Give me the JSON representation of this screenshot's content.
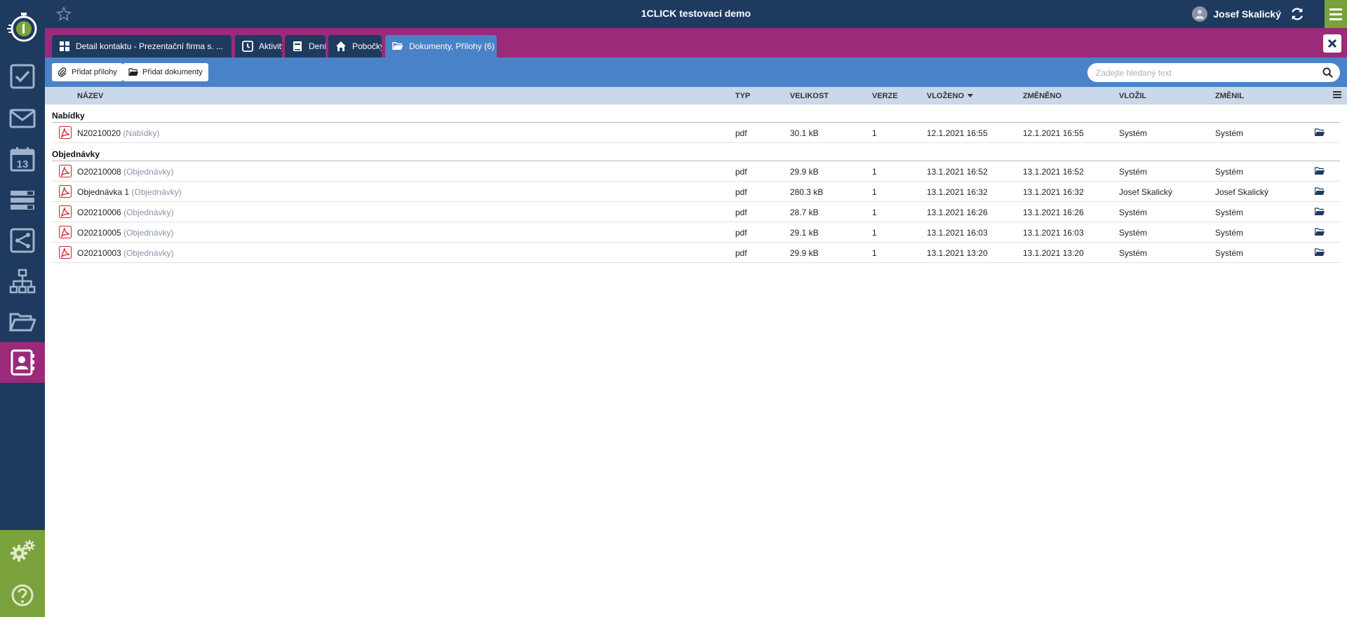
{
  "app": {
    "title": "1CLICK testovací demo"
  },
  "user": {
    "name": "Josef Skalický"
  },
  "colors": {
    "navy": "#1e3a5f",
    "magenta": "#9b2a7a",
    "blue": "#4a82c7",
    "green": "#7aa23c",
    "header": "#c9d8ea",
    "pdf_red": "#d0202a"
  },
  "sidebar": {
    "items": [
      {
        "icon": "checkbox-icon"
      },
      {
        "icon": "envelope-icon"
      },
      {
        "icon": "calendar-icon",
        "text": "13"
      },
      {
        "icon": "list-icon"
      },
      {
        "icon": "workflow-icon"
      },
      {
        "icon": "org-chart-icon"
      },
      {
        "icon": "folder-open-icon"
      },
      {
        "icon": "contact-card-icon",
        "active": true
      }
    ],
    "bottom": [
      {
        "icon": "gears-icon"
      },
      {
        "icon": "help-icon"
      }
    ]
  },
  "tabs": [
    {
      "label": "Detail kontaktu - Prezentační firma s. ...",
      "icon": "grid-icon"
    },
    {
      "label": "Aktivity",
      "icon": "clock-icon"
    },
    {
      "label": "Deník",
      "icon": "book-icon"
    },
    {
      "label": "Pobočky",
      "icon": "home-icon"
    },
    {
      "label": "Dokumenty, Přílohy (6)",
      "icon": "folder-icon",
      "active": true
    }
  ],
  "toolbar": {
    "add_attachments": "Přidat přílohy",
    "add_documents": "Přidat dokumenty",
    "search_placeholder": "Zadejte hledaný text"
  },
  "table": {
    "headers": {
      "name": "NÁZEV",
      "type": "TYP",
      "size": "VELIKOST",
      "version": "VERZE",
      "inserted": "VLOŽENO",
      "changed": "ZMĚNĚNO",
      "inserted_by": "VLOŽIL",
      "changed_by": "ZMĚNIL"
    },
    "sorted_by": "inserted",
    "groups": [
      {
        "title": "Nabídky",
        "rows": [
          {
            "name": "N20210020",
            "category": "(Nabídky)",
            "type": "pdf",
            "size": "30.1 kB",
            "version": "1",
            "inserted": "12.1.2021 16:55",
            "changed": "12.1.2021 16:55",
            "inserted_by": "Systém",
            "changed_by": "Systém"
          }
        ]
      },
      {
        "title": "Objednávky",
        "rows": [
          {
            "name": "O20210008",
            "category": "(Objednávky)",
            "type": "pdf",
            "size": "29.9 kB",
            "version": "1",
            "inserted": "13.1.2021 16:52",
            "changed": "13.1.2021 16:52",
            "inserted_by": "Systém",
            "changed_by": "Systém"
          },
          {
            "name": "Objednávka 1",
            "category": "(Objednávky)",
            "type": "pdf",
            "size": "280.3 kB",
            "version": "1",
            "inserted": "13.1.2021 16:32",
            "changed": "13.1.2021 16:32",
            "inserted_by": "Josef Skalický",
            "changed_by": "Josef Skalický"
          },
          {
            "name": "O20210006",
            "category": "(Objednávky)",
            "type": "pdf",
            "size": "28.7 kB",
            "version": "1",
            "inserted": "13.1.2021 16:26",
            "changed": "13.1.2021 16:26",
            "inserted_by": "Systém",
            "changed_by": "Systém"
          },
          {
            "name": "O20210005",
            "category": "(Objednávky)",
            "type": "pdf",
            "size": "29.1 kB",
            "version": "1",
            "inserted": "13.1.2021 16:03",
            "changed": "13.1.2021 16:03",
            "inserted_by": "Systém",
            "changed_by": "Systém"
          },
          {
            "name": "O20210003",
            "category": "(Objednávky)",
            "type": "pdf",
            "size": "29.9 kB",
            "version": "1",
            "inserted": "13.1.2021 13:20",
            "changed": "13.1.2021 13:20",
            "inserted_by": "Systém",
            "changed_by": "Systém"
          }
        ]
      }
    ]
  }
}
